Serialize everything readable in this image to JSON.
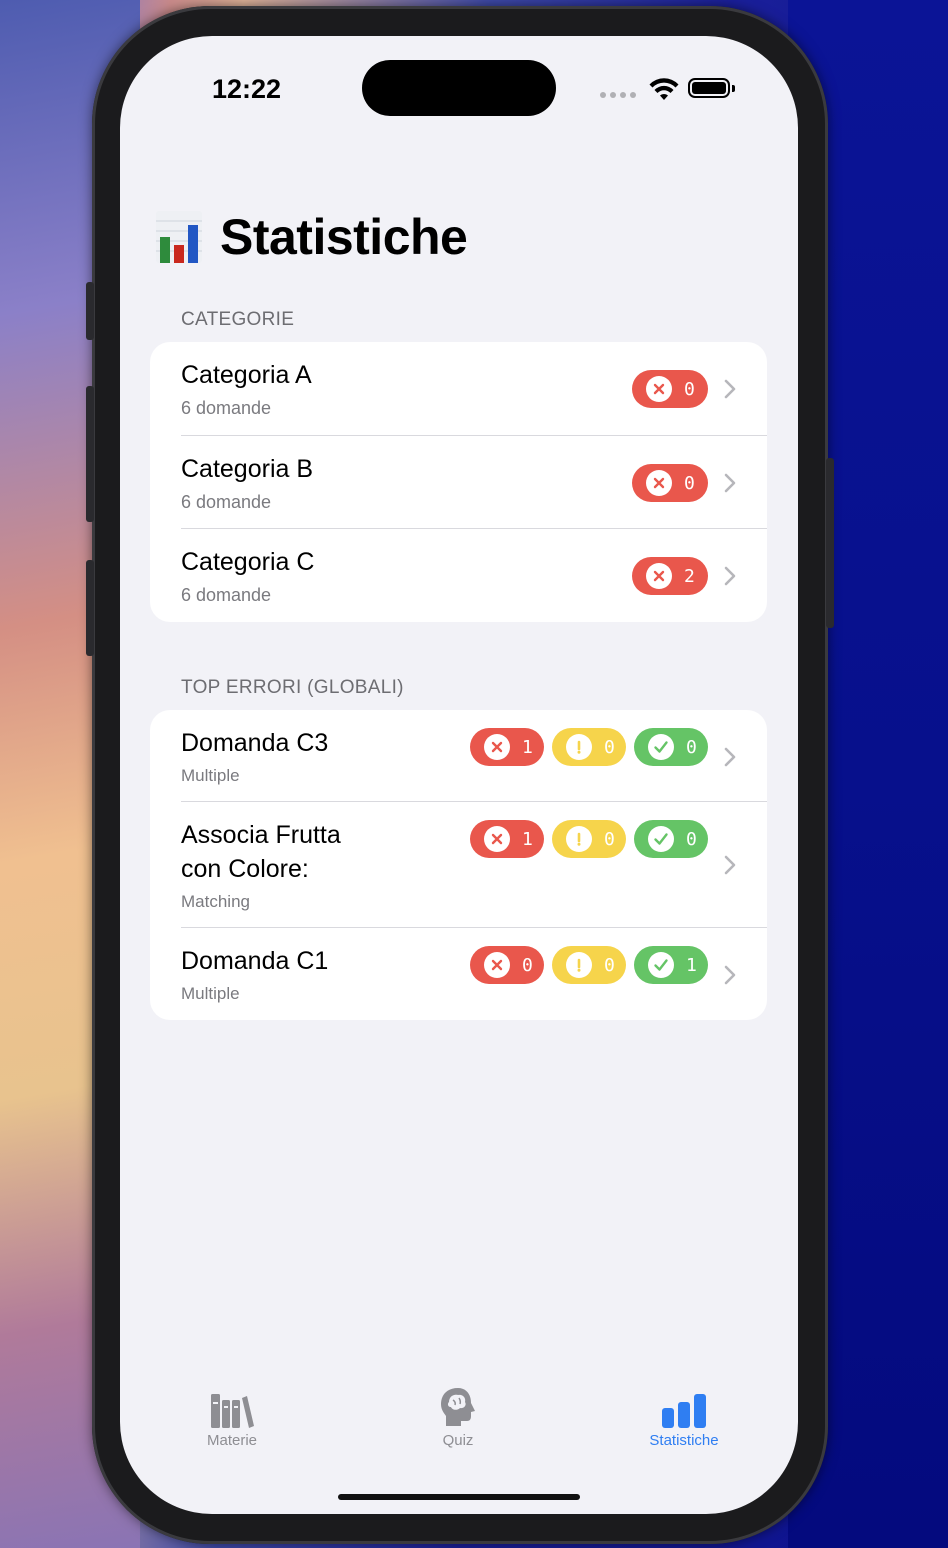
{
  "status_bar": {
    "time": "12:22"
  },
  "page": {
    "title": "Statistiche",
    "title_icon": "bar-chart-emoji"
  },
  "categories_section": {
    "header": "CATEGORIE",
    "rows": [
      {
        "title": "Categoria A",
        "subtitle": "6 domande",
        "errors": "0"
      },
      {
        "title": "Categoria B",
        "subtitle": "6 domande",
        "errors": "0"
      },
      {
        "title": "Categoria C",
        "subtitle": "6 domande",
        "errors": "2"
      }
    ]
  },
  "top_errors_section": {
    "header": "TOP ERRORI (GLOBALI)",
    "rows": [
      {
        "title": "Domanda C3",
        "subtitle": "Multiple",
        "wrong": "1",
        "partial": "0",
        "correct": "0"
      },
      {
        "title_line1": "Associa Frutta",
        "title_line2": "con Colore:",
        "subtitle": "Matching",
        "wrong": "1",
        "partial": "0",
        "correct": "0"
      },
      {
        "title": "Domanda C1",
        "subtitle": "Multiple",
        "wrong": "0",
        "partial": "0",
        "correct": "1"
      }
    ]
  },
  "tab_bar": {
    "tabs": [
      {
        "label": "Materie",
        "icon": "books-icon"
      },
      {
        "label": "Quiz",
        "icon": "brain-head-icon"
      },
      {
        "label": "Statistiche",
        "icon": "bar-chart-icon",
        "active": true
      }
    ]
  },
  "colors": {
    "red": "#e9574c",
    "yellow": "#f6d44b",
    "green": "#65c466",
    "accent": "#2f7ef2"
  }
}
